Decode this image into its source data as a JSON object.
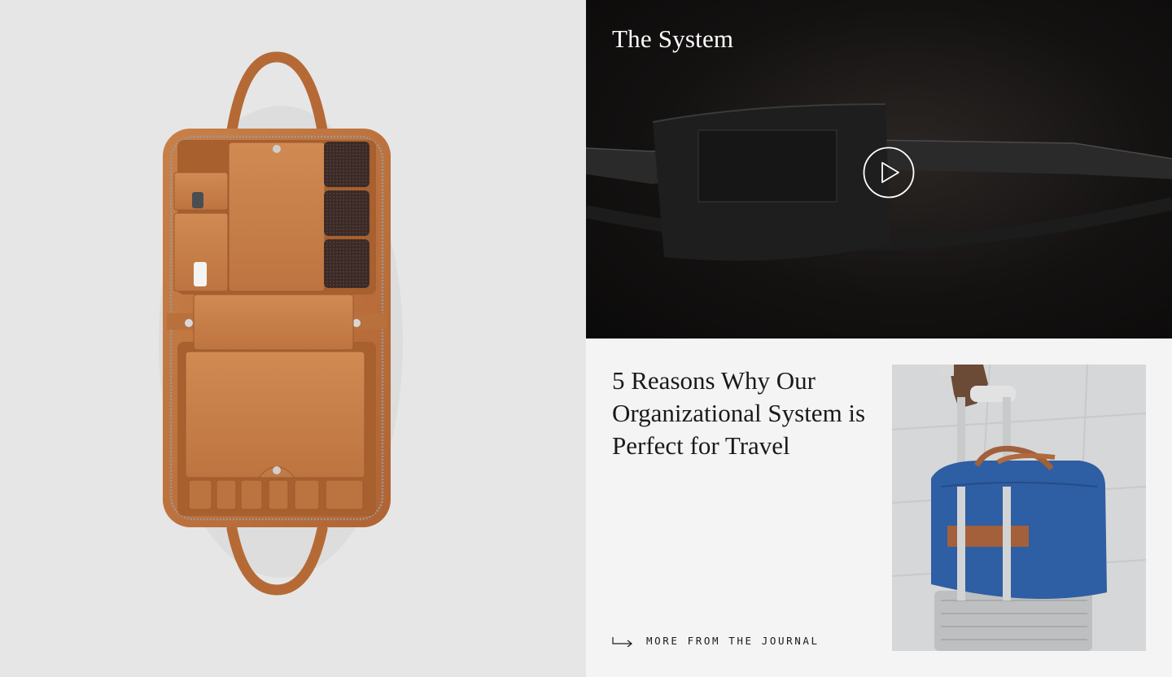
{
  "video": {
    "title": "The System",
    "play_icon": "play-circle-icon"
  },
  "article": {
    "title": "5 Reasons Why Our Organizational System is Perfect for Travel",
    "link_label": "MORE FROM THE JOURNAL",
    "link_icon": "arrow-right-icon"
  },
  "colors": {
    "left_background": "#e6e6e6",
    "video_background": "#141211",
    "article_background": "#f4f4f4",
    "leather_tan": "#c0743d",
    "bag_blue": "#2e5ea3"
  }
}
